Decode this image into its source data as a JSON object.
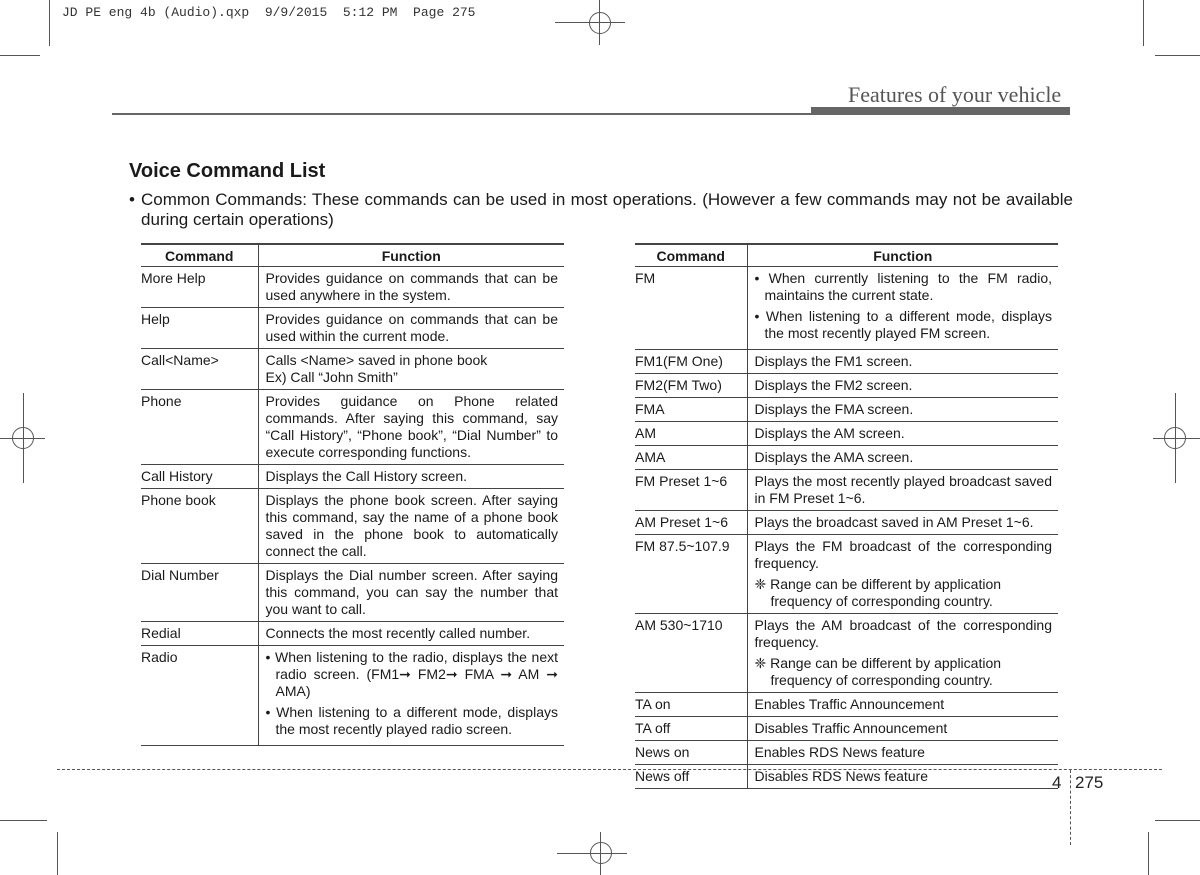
{
  "slug": "JD PE eng 4b (Audio).qxp  9/9/2015  5:12 PM  Page 275",
  "header": {
    "section_title": "Features of your vehicle"
  },
  "title": "Voice Command List",
  "intro": {
    "bullet": "•",
    "text": "Common Commands: These commands can be used in most operations. (However a few commands may not be available during certain operations)"
  },
  "table_headers": {
    "command": "Command",
    "function": "Function"
  },
  "left_table": [
    {
      "command": "More Help",
      "function": [
        "Provides guidance on commands that can be used anywhere in the system."
      ]
    },
    {
      "command": "Help",
      "function": [
        "Provides guidance on commands that can be used within the current mode."
      ]
    },
    {
      "command": "Call<Name>",
      "function": [
        "Calls <Name> saved in phone book",
        "Ex) Call “John Smith”"
      ]
    },
    {
      "command": "Phone",
      "function": [
        "Provides guidance on Phone related commands. After saying this command, say “Call History”, “Phone book”, “Dial Number” to execute corresponding functions."
      ]
    },
    {
      "command": "Call History",
      "function": [
        "Displays the Call History screen."
      ]
    },
    {
      "command": "Phone book",
      "function": [
        "Displays the phone book screen. After saying this command, say the name of a phone book saved in the phone book to automatically connect the call."
      ]
    },
    {
      "command": "Dial Number",
      "function": [
        "Displays the Dial number screen. After saying this command, you can say the number that you want to call."
      ]
    },
    {
      "command": "Redial",
      "function": [
        "Connects the most recently called number."
      ]
    },
    {
      "command": "Radio",
      "bullets": [
        "• When listening to the radio, displays the next radio screen. (FM1➞ FM2➞ FMA ➞ AM ➞ AMA)",
        "• When listening to a different mode, displays the most recently played radio screen."
      ]
    }
  ],
  "right_table": [
    {
      "command": "FM",
      "bullets": [
        "• When currently listening to the FM radio, maintains the current state.",
        "• When listening to a different mode, displays the most recently played FM screen."
      ]
    },
    {
      "command": "FM1(FM One)",
      "function": [
        "Displays the FM1 screen."
      ]
    },
    {
      "command": "FM2(FM Two)",
      "function": [
        "Displays the FM2 screen."
      ]
    },
    {
      "command": "FMA",
      "function": [
        "Displays the FMA screen."
      ]
    },
    {
      "command": "AM",
      "function": [
        "Displays the AM screen."
      ]
    },
    {
      "command": "AMA",
      "function": [
        "Displays the AMA screen."
      ]
    },
    {
      "command": "FM Preset 1~6",
      "function": [
        "Plays the most recently played broadcast saved in FM Preset 1~6."
      ]
    },
    {
      "command": "AM Preset 1~6",
      "function": [
        "Plays the broadcast saved in AM Preset 1~6."
      ]
    },
    {
      "command": "FM 87.5~107.9",
      "function": [
        "Plays the FM broadcast of the corresponding frequency."
      ],
      "note": "❈ Range can be different by application frequency of corresponding country."
    },
    {
      "command": "AM 530~1710",
      "function": [
        "Plays the AM broadcast of the corresponding frequency."
      ],
      "note": "❈ Range can be different by application frequency of corresponding country."
    },
    {
      "command": "TA on",
      "function": [
        "Enables Traffic Announcement"
      ]
    },
    {
      "command": "TA off",
      "function": [
        "Disables Traffic Announcement"
      ]
    },
    {
      "command": "News on",
      "function": [
        "Enables RDS News feature"
      ]
    },
    {
      "command": "News off",
      "function": [
        "Disables RDS News feature"
      ]
    }
  ],
  "footer": {
    "chapter": "4",
    "page": "275"
  }
}
